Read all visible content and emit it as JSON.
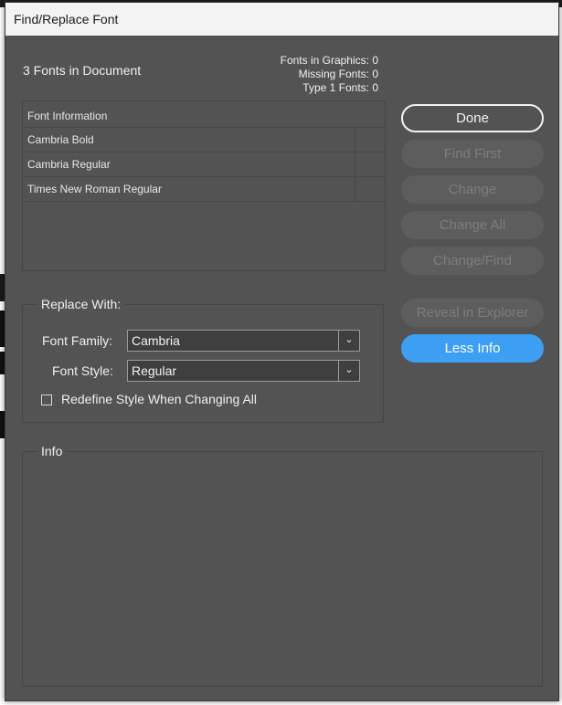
{
  "window": {
    "title": "Find/Replace Font"
  },
  "summary": {
    "fonts_in_document": "3 Fonts in Document",
    "fonts_in_graphics": "Fonts in Graphics: 0",
    "missing_fonts": "Missing Fonts: 0",
    "type1_fonts": "Type 1 Fonts: 0"
  },
  "font_table": {
    "header": "Font Information",
    "rows": [
      "Cambria Bold",
      "Cambria Regular",
      "Times New Roman Regular"
    ]
  },
  "buttons": {
    "done": "Done",
    "find_first": "Find First",
    "change": "Change",
    "change_all": "Change All",
    "change_find": "Change/Find",
    "reveal": "Reveal in Explorer",
    "less_info": "Less Info"
  },
  "replace_with": {
    "legend": "Replace With:",
    "font_family_label": "Font Family:",
    "font_family_value": "Cambria",
    "font_style_label": "Font Style:",
    "font_style_value": "Regular",
    "redefine_label": "Redefine Style When Changing All",
    "redefine_checked": false
  },
  "info": {
    "legend": "Info"
  },
  "colors": {
    "dialog_bg": "#535353",
    "accent": "#3c9ff4",
    "titlebar_bg": "#f3f3f3"
  }
}
